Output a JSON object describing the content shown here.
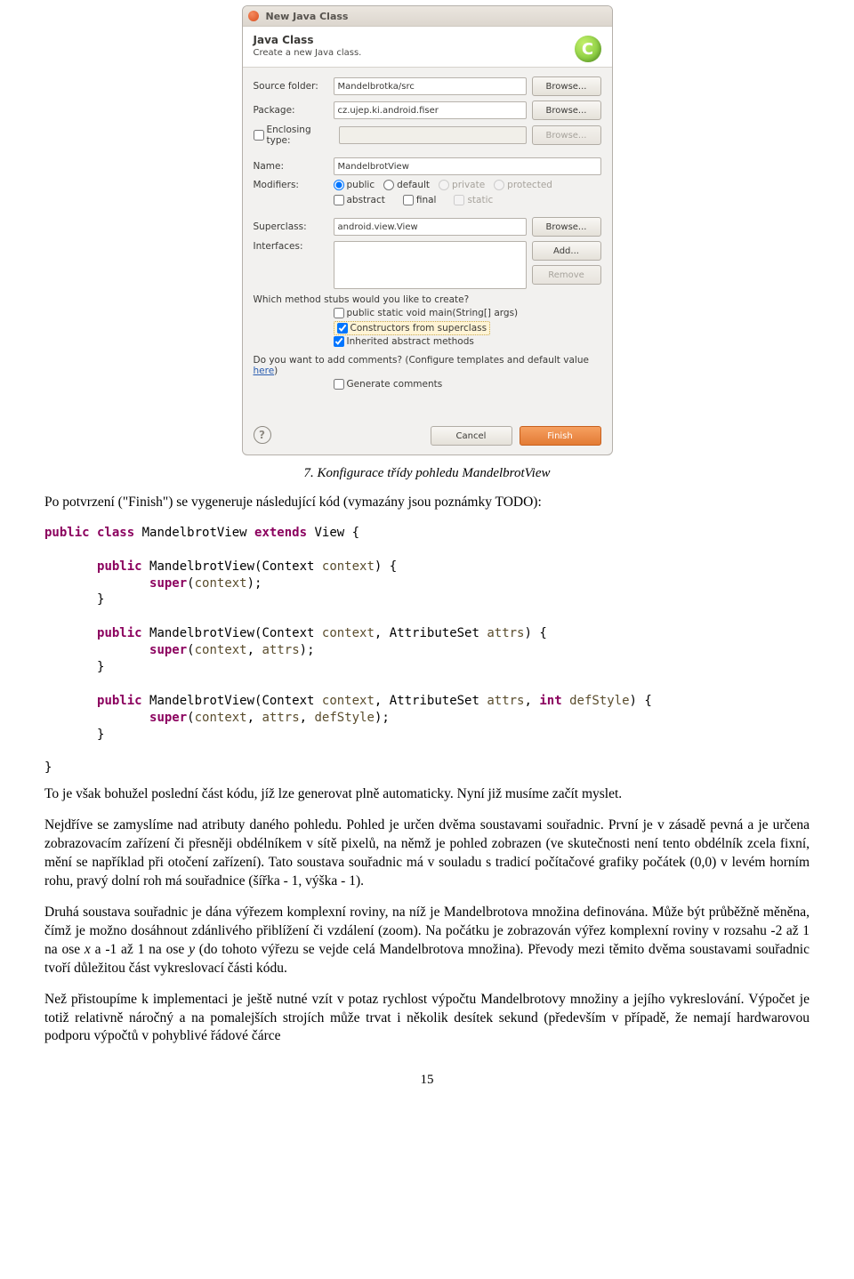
{
  "dialog": {
    "title": "New Java Class",
    "banner_title": "Java Class",
    "banner_sub": "Create a new Java class.",
    "source_folder_lbl": "Source folder:",
    "source_folder_val": "Mandelbrotka/src",
    "package_lbl": "Package:",
    "package_val": "cz.ujep.ki.android.fiser",
    "enclosing_lbl": "Enclosing type:",
    "name_lbl": "Name:",
    "name_val": "MandelbrotView",
    "modifiers_lbl": "Modifiers:",
    "mod_public": "public",
    "mod_default": "default",
    "mod_private": "private",
    "mod_protected": "protected",
    "mod_abstract": "abstract",
    "mod_final": "final",
    "mod_static": "static",
    "superclass_lbl": "Superclass:",
    "superclass_val": "android.view.View",
    "interfaces_lbl": "Interfaces:",
    "q1": "Which method stubs would you like to create?",
    "stub_main": "public static void main(String[] args)",
    "stub_ctor": "Constructors from superclass",
    "stub_inh": "Inherited abstract methods",
    "q2_pre": "Do you want to add comments? (Configure templates and default value ",
    "q2_link": "here",
    "q2_post": ")",
    "gen_comments": "Generate comments",
    "browse": "Browse...",
    "add": "Add...",
    "remove": "Remove",
    "cancel": "Cancel",
    "finish": "Finish"
  },
  "caption": "7. Konfigurace třídy pohledu MandelbrotView",
  "para_intro": "Po potvrzení (\"Finish\") se vygeneruje následující kód (vymazány jsou poznámky TODO):",
  "para_after_code": "To je však bohužel poslední část kódu, jíž lze generovat plně automaticky. Nyní již musíme začít myslet.",
  "para3": "Nejdříve se zamyslíme nad atributy daného pohledu. Pohled je určen dvěma soustavami souřadnic. První je v zásadě pevná a je určena zobrazovacím zařízení či přesněji obdélníkem v sítě pixelů, na němž je pohled zobrazen (ve skutečnosti není tento obdélník zcela fixní, mění se například při otočení zařízení). Tato soustava souřadnic má v souladu s tradicí počítačové grafiky počátek (0,0) v levém horním rohu, pravý dolní roh má souřadnice (šířka - 1, výška - 1).",
  "para4_pre": "Druhá soustava souřadnic je dána výřezem komplexní roviny, na níž je Mandelbrotova množina definována. Může být průběžně měněna, čímž je možno dosáhnout zdánlivého přiblížení či vzdálení (zoom). Na počátku je zobrazován výřez komplexní roviny v rozsahu -2 až  1 na ose ",
  "para4_x": "x",
  "para4_mid": " a -1 až 1 na ose ",
  "para4_y": "y",
  "para4_post": " (do tohoto výřezu se vejde celá Mandelbrotova množina).  Převody mezi těmito dvěma soustavami souřadnic tvoří důležitou část vykreslovací části kódu.",
  "para5": "Než přistoupíme k implementaci je ještě nutné vzít v potaz rychlost výpočtu Mandelbrotovy množiny a jejího vykreslování.  Výpočet je totiž relativně náročný a na pomalejších strojích může trvat i několik desítek sekund (především v případě, že nemají hardwarovou podporu výpočtů v pohyblivé řádové čárce",
  "pagenum": "15"
}
